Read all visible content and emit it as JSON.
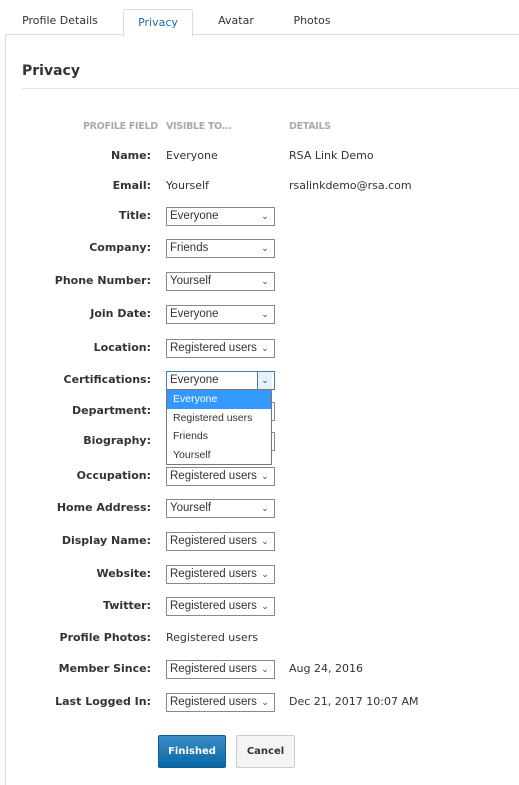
{
  "tabs": [
    {
      "label": "Profile Details"
    },
    {
      "label": "Privacy"
    },
    {
      "label": "Avatar"
    },
    {
      "label": "Photos"
    }
  ],
  "active_tab": "Privacy",
  "title": "Privacy",
  "headers": {
    "field": "PROFILE FIELD",
    "visible": "VISIBLE TO...",
    "details": "DETAILS"
  },
  "rows": [
    {
      "label": "Name:",
      "type": "text",
      "value": "Everyone",
      "details": "RSA Link Demo"
    },
    {
      "label": "Email:",
      "type": "text",
      "value": "Yourself",
      "details": "rsalinkdemo@rsa.com"
    },
    {
      "label": "Title:",
      "type": "select",
      "value": "Everyone"
    },
    {
      "label": "Company:",
      "type": "select",
      "value": "Friends"
    },
    {
      "label": "Phone Number:",
      "type": "select",
      "value": "Yourself"
    },
    {
      "label": "Join Date:",
      "type": "select",
      "value": "Everyone"
    },
    {
      "label": "Location:",
      "type": "select",
      "value": "Registered users"
    },
    {
      "label": "Certifications:",
      "type": "select",
      "value": "Everyone",
      "open": true
    },
    {
      "label": "Department:",
      "type": "select",
      "value": ""
    },
    {
      "label": "Biography:",
      "type": "select",
      "value": ""
    },
    {
      "label": "Occupation:",
      "type": "select",
      "value": "Registered users"
    },
    {
      "label": "Home Address:",
      "type": "select",
      "value": "Yourself"
    },
    {
      "label": "Display Name:",
      "type": "select",
      "value": "Registered users"
    },
    {
      "label": "Website:",
      "type": "select",
      "value": "Registered users"
    },
    {
      "label": "Twitter:",
      "type": "select",
      "value": "Registered users"
    },
    {
      "label": "Profile Photos:",
      "type": "text",
      "value": "Registered users"
    },
    {
      "label": "Member Since:",
      "type": "select",
      "value": "Registered users",
      "details": "Aug 24, 2016"
    },
    {
      "label": "Last Logged In:",
      "type": "select",
      "value": "Registered users",
      "details": "Dec 21, 2017 10:07 AM"
    }
  ],
  "dropdown_options": [
    "Everyone",
    "Registered users",
    "Friends",
    "Yourself"
  ],
  "dropdown_highlighted": "Everyone",
  "buttons": {
    "finished": "Finished",
    "cancel": "Cancel"
  },
  "colors": {
    "primary": "#0a67a5",
    "highlight": "#3399ff",
    "tab_active": "#1a6ea8"
  }
}
